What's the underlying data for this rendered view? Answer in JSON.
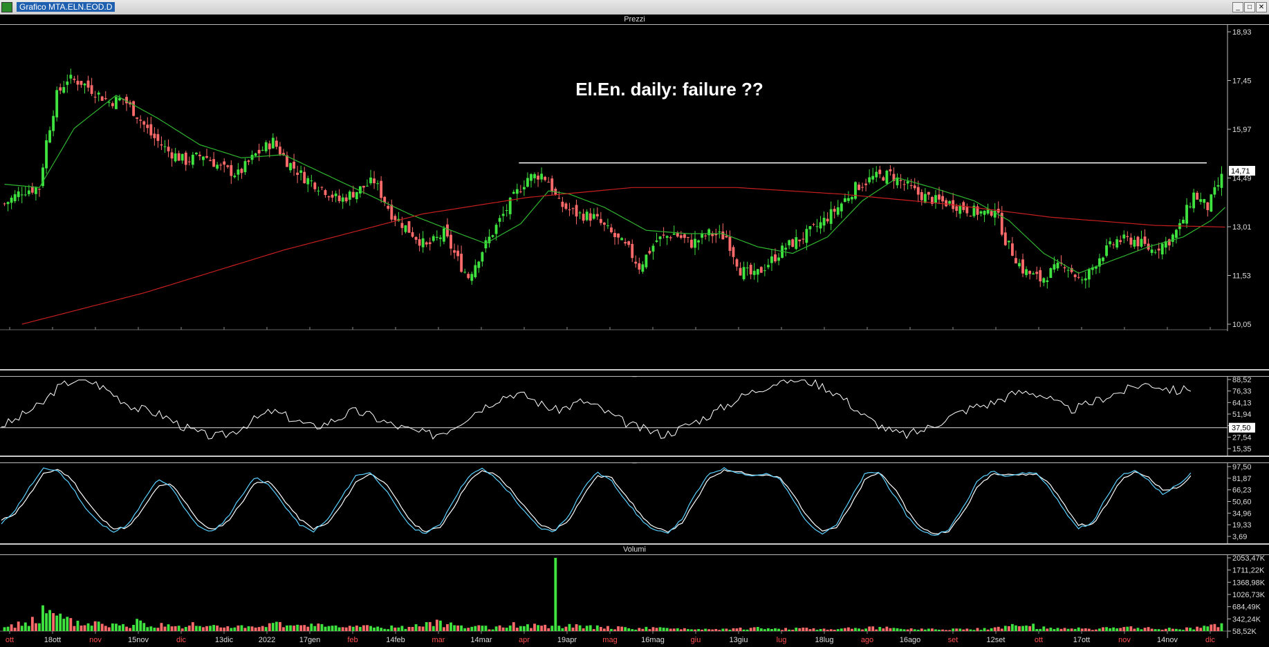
{
  "window": {
    "title": "Grafico MTA.ELN.EOD.D",
    "btn_min": "_",
    "btn_max": "□",
    "btn_close": "✕"
  },
  "panels": {
    "price": {
      "header": "Prezzi",
      "annotation": "El.En. daily: failure ??"
    },
    "rsi": {
      "header": "_"
    },
    "stoch": {
      "header": "_"
    },
    "volume": {
      "header": "Volumi"
    }
  },
  "colors": {
    "up": "#3fe33f",
    "down": "#ff6a6a",
    "ma_short": "#2fb52f",
    "ma_long": "#c71f1f",
    "rsi": "#ffffff",
    "stoch_k": "#5ad0ff",
    "stoch_d": "#ffffff",
    "resistance": "#ffffff"
  },
  "chart_data": [
    {
      "type": "candlestick",
      "title": "El.En. daily: failure ??",
      "ylim": [
        10.05,
        18.93
      ],
      "y_ticks": [
        "18,93",
        "17,45",
        "15,97",
        "14,49",
        "13,01",
        "11,53",
        "10,05"
      ],
      "last_price": "14,71",
      "resistance_level": 14.95,
      "x_labels": [
        {
          "label": "ott",
          "red": true
        },
        {
          "label": "18ott",
          "red": false
        },
        {
          "label": "nov",
          "red": true
        },
        {
          "label": "15nov",
          "red": false
        },
        {
          "label": "dic",
          "red": true
        },
        {
          "label": "13dic",
          "red": false
        },
        {
          "label": "2022",
          "red": false
        },
        {
          "label": "17gen",
          "red": false
        },
        {
          "label": "feb",
          "red": true
        },
        {
          "label": "14feb",
          "red": false
        },
        {
          "label": "mar",
          "red": true
        },
        {
          "label": "14mar",
          "red": false
        },
        {
          "label": "apr",
          "red": true
        },
        {
          "label": "19apr",
          "red": false
        },
        {
          "label": "mag",
          "red": true
        },
        {
          "label": "16mag",
          "red": false
        },
        {
          "label": "giu",
          "red": true
        },
        {
          "label": "13giu",
          "red": false
        },
        {
          "label": "lug",
          "red": true
        },
        {
          "label": "18lug",
          "red": false
        },
        {
          "label": "ago",
          "red": true
        },
        {
          "label": "16ago",
          "red": false
        },
        {
          "label": "set",
          "red": true
        },
        {
          "label": "12set",
          "red": false
        },
        {
          "label": "ott",
          "red": true
        },
        {
          "label": "17ott",
          "red": false
        },
        {
          "label": "nov",
          "red": true
        },
        {
          "label": "14nov",
          "red": false
        },
        {
          "label": "dic",
          "red": true
        }
      ],
      "close_path": [
        [
          0,
          13.7
        ],
        [
          5,
          14.1
        ],
        [
          10,
          14.2
        ],
        [
          12,
          15.6
        ],
        [
          15,
          17.0
        ],
        [
          18,
          17.5
        ],
        [
          22,
          17.4
        ],
        [
          26,
          17.1
        ],
        [
          30,
          16.8
        ],
        [
          34,
          16.9
        ],
        [
          38,
          16.4
        ],
        [
          42,
          15.8
        ],
        [
          47,
          15.3
        ],
        [
          52,
          15.0
        ],
        [
          57,
          15.2
        ],
        [
          62,
          14.8
        ],
        [
          67,
          14.6
        ],
        [
          72,
          15.2
        ],
        [
          77,
          15.6
        ],
        [
          81,
          15.0
        ],
        [
          86,
          14.5
        ],
        [
          91,
          14.2
        ],
        [
          96,
          13.8
        ],
        [
          101,
          14.1
        ],
        [
          106,
          14.4
        ],
        [
          111,
          13.4
        ],
        [
          116,
          12.9
        ],
        [
          121,
          12.4
        ],
        [
          126,
          12.8
        ],
        [
          131,
          11.8
        ],
        [
          133,
          11.5
        ],
        [
          137,
          12.3
        ],
        [
          142,
          13.2
        ],
        [
          146,
          13.9
        ],
        [
          150,
          14.5
        ],
        [
          154,
          14.6
        ],
        [
          156,
          14.4
        ],
        [
          159,
          13.7
        ],
        [
          164,
          13.4
        ],
        [
          169,
          13.3
        ],
        [
          174,
          12.8
        ],
        [
          179,
          12.3
        ],
        [
          182,
          11.8
        ],
        [
          187,
          12.6
        ],
        [
          192,
          12.8
        ],
        [
          197,
          12.5
        ],
        [
          202,
          12.8
        ],
        [
          207,
          12.7
        ],
        [
          211,
          11.7
        ],
        [
          215,
          11.5
        ],
        [
          219,
          11.9
        ],
        [
          224,
          12.4
        ],
        [
          229,
          12.7
        ],
        [
          234,
          13.1
        ],
        [
          239,
          13.6
        ],
        [
          244,
          14.2
        ],
        [
          249,
          14.5
        ],
        [
          254,
          14.6
        ],
        [
          258,
          14.3
        ],
        [
          262,
          14.0
        ],
        [
          267,
          13.8
        ],
        [
          272,
          13.7
        ],
        [
          277,
          13.5
        ],
        [
          282,
          13.4
        ],
        [
          284,
          13.6
        ],
        [
          287,
          12.6
        ],
        [
          292,
          11.7
        ],
        [
          297,
          11.4
        ],
        [
          301,
          11.7
        ],
        [
          304,
          11.9
        ],
        [
          309,
          11.3
        ],
        [
          314,
          12.1
        ],
        [
          319,
          12.6
        ],
        [
          324,
          12.6
        ],
        [
          329,
          12.3
        ],
        [
          334,
          12.6
        ],
        [
          337,
          13.0
        ],
        [
          341,
          14.0
        ],
        [
          345,
          13.6
        ],
        [
          349,
          14.5
        ],
        [
          350,
          14.75
        ]
      ],
      "ma_short_path": [
        [
          0,
          14.3
        ],
        [
          10,
          14.2
        ],
        [
          20,
          16.0
        ],
        [
          32,
          17.0
        ],
        [
          44,
          16.3
        ],
        [
          56,
          15.5
        ],
        [
          68,
          15.1
        ],
        [
          80,
          15.2
        ],
        [
          92,
          14.6
        ],
        [
          104,
          14.0
        ],
        [
          116,
          13.4
        ],
        [
          128,
          12.9
        ],
        [
          138,
          12.5
        ],
        [
          148,
          13.1
        ],
        [
          156,
          14.1
        ],
        [
          162,
          14.0
        ],
        [
          172,
          13.6
        ],
        [
          184,
          12.9
        ],
        [
          196,
          12.8
        ],
        [
          206,
          12.8
        ],
        [
          216,
          12.4
        ],
        [
          226,
          12.2
        ],
        [
          236,
          12.7
        ],
        [
          246,
          13.8
        ],
        [
          256,
          14.5
        ],
        [
          266,
          14.2
        ],
        [
          278,
          13.8
        ],
        [
          288,
          13.2
        ],
        [
          298,
          12.2
        ],
        [
          308,
          11.6
        ],
        [
          318,
          12.0
        ],
        [
          328,
          12.4
        ],
        [
          338,
          12.7
        ],
        [
          346,
          13.2
        ],
        [
          350,
          13.6
        ]
      ],
      "ma_long_path": [
        [
          5,
          10.05
        ],
        [
          40,
          11.0
        ],
        [
          80,
          12.3
        ],
        [
          120,
          13.4
        ],
        [
          150,
          13.9
        ],
        [
          180,
          14.2
        ],
        [
          210,
          14.2
        ],
        [
          240,
          14.0
        ],
        [
          270,
          13.7
        ],
        [
          300,
          13.3
        ],
        [
          330,
          13.05
        ],
        [
          350,
          13.0
        ]
      ]
    },
    {
      "type": "line",
      "ylim": [
        15.35,
        88.52
      ],
      "y_ticks": [
        "88,52",
        "76,33",
        "64,13",
        "51,94",
        "37,50",
        "27,54",
        "15,35"
      ],
      "reference_level": 37.5,
      "series": [
        {
          "values": [
            40,
            45,
            55,
            62,
            78,
            86,
            90,
            84,
            76,
            66,
            58,
            55,
            50,
            42,
            35,
            30,
            28,
            32,
            40,
            48,
            55,
            50,
            44,
            38,
            42,
            48,
            55,
            52,
            46,
            40,
            36,
            32,
            30,
            35,
            44,
            54,
            62,
            70,
            74,
            70,
            62,
            56,
            60,
            66,
            60,
            52,
            44,
            38,
            34,
            30,
            35,
            42,
            48,
            56,
            64,
            72,
            78,
            84,
            88,
            88,
            86,
            80,
            72,
            60,
            48,
            40,
            32,
            30,
            34,
            40,
            48,
            54,
            60,
            62,
            68,
            74,
            76,
            72,
            64,
            56,
            60,
            66,
            72,
            76,
            82,
            84,
            80,
            76,
            80
          ]
        }
      ]
    },
    {
      "type": "line",
      "ylim": [
        3.69,
        97.5
      ],
      "y_ticks": [
        "97,50",
        "81,87",
        "66,23",
        "50,60",
        "34,96",
        "19,33",
        "3,69"
      ],
      "series": [
        {
          "values": [
            20,
            40,
            70,
            95,
            92,
            70,
            40,
            20,
            10,
            20,
            50,
            80,
            70,
            40,
            15,
            10,
            30,
            60,
            85,
            70,
            45,
            20,
            10,
            25,
            55,
            85,
            90,
            70,
            40,
            15,
            8,
            20,
            55,
            85,
            95,
            80,
            60,
            35,
            15,
            10,
            30,
            65,
            90,
            80,
            55,
            30,
            12,
            8,
            25,
            60,
            88,
            95,
            90,
            85,
            88,
            80,
            50,
            20,
            8,
            20,
            55,
            88,
            90,
            60,
            30,
            10,
            5,
            15,
            45,
            80,
            92,
            85,
            88,
            90,
            70,
            40,
            15,
            20,
            55,
            85,
            92,
            80,
            60,
            72,
            88
          ]
        },
        {
          "values": [
            25,
            35,
            60,
            88,
            94,
            80,
            52,
            28,
            14,
            16,
            40,
            70,
            74,
            50,
            22,
            12,
            24,
            50,
            78,
            76,
            52,
            28,
            14,
            20,
            45,
            76,
            88,
            78,
            50,
            22,
            10,
            16,
            45,
            78,
            92,
            86,
            66,
            42,
            20,
            12,
            24,
            55,
            84,
            84,
            62,
            36,
            16,
            10,
            20,
            50,
            82,
            92,
            92,
            86,
            86,
            82,
            58,
            28,
            12,
            16,
            45,
            80,
            90,
            70,
            38,
            14,
            7,
            12,
            38,
            72,
            88,
            88,
            86,
            88,
            76,
            48,
            20,
            18,
            45,
            78,
            90,
            84,
            66,
            68,
            84
          ]
        }
      ]
    },
    {
      "type": "bar",
      "ylim": [
        0,
        2053.47
      ],
      "y_ticks": [
        "2053,47K",
        "1711,22K",
        "1368,98K",
        "1026,73K",
        "684,49K",
        "342,24K",
        "58,52K"
      ],
      "values": [
        120,
        180,
        240,
        310,
        520,
        400,
        280,
        220,
        200,
        250,
        180,
        160,
        140,
        380,
        160,
        210,
        150,
        130,
        170,
        120,
        140,
        130,
        120,
        110,
        100,
        160,
        200,
        140,
        120,
        170,
        180,
        120,
        100,
        130,
        150,
        110,
        90,
        120,
        100,
        140,
        170,
        260,
        200,
        150,
        120,
        110,
        90,
        130,
        170,
        150,
        140,
        120,
        2053,
        150,
        130,
        120,
        110,
        100,
        90,
        80,
        70,
        85,
        75,
        65,
        70,
        60,
        55,
        65,
        60,
        60,
        70,
        80,
        65,
        55,
        60,
        75,
        80,
        70,
        60,
        65,
        70,
        80,
        90,
        85,
        75,
        70,
        65,
        60,
        55,
        50,
        60,
        70,
        65,
        75,
        120,
        140,
        160,
        150,
        110,
        90,
        80,
        70,
        60,
        60,
        75,
        85,
        95,
        90,
        80,
        70,
        65,
        60,
        80,
        110,
        160,
        150
      ]
    }
  ]
}
